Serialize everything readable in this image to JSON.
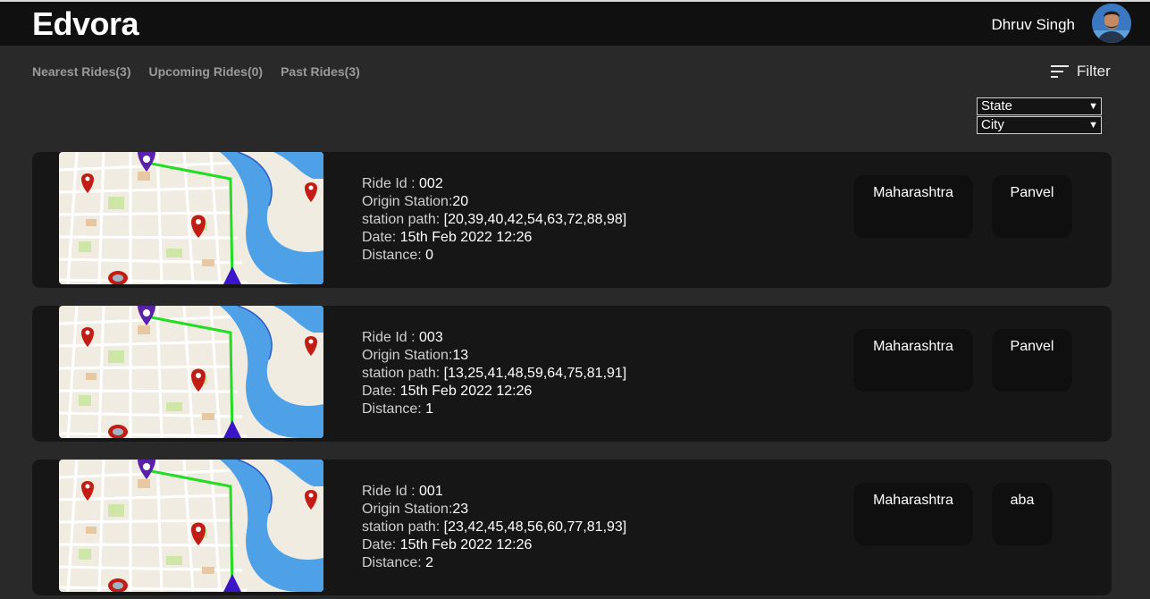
{
  "header": {
    "brand": "Edvora",
    "user_name": "Dhruv Singh"
  },
  "tabs": [
    {
      "label": "Nearest Rides(3)"
    },
    {
      "label": "Upcoming Rides(0)"
    },
    {
      "label": "Past Rides(3)"
    }
  ],
  "filter": {
    "label": "Filter",
    "state_select": "State",
    "city_select": "City"
  },
  "labels": {
    "ride_id": "Ride Id : ",
    "origin_station": "Origin Station:",
    "station_path": "station path: ",
    "date": "Date: ",
    "distance": "Distance: "
  },
  "rides": [
    {
      "ride_id": "002",
      "origin_station": "20",
      "station_path": "[20,39,40,42,54,63,72,88,98]",
      "date": "15th Feb 2022 12:26",
      "distance": "0",
      "state": "Maharashtra",
      "city": "Panvel"
    },
    {
      "ride_id": "003",
      "origin_station": "13",
      "station_path": "[13,25,41,48,59,64,75,81,91]",
      "date": "15th Feb 2022 12:26",
      "distance": "1",
      "state": "Maharashtra",
      "city": "Panvel"
    },
    {
      "ride_id": "001",
      "origin_station": "23",
      "station_path": "[23,42,45,48,56,60,77,81,93]",
      "date": "15th Feb 2022 12:26",
      "distance": "2",
      "state": "Maharashtra",
      "city": "aba"
    }
  ],
  "colors": {
    "background": "#292929",
    "topbar": "#101010",
    "card": "#161616",
    "chip": "#0f0f0f",
    "tab_text": "#9a9a9a",
    "route_line": "#22dd22",
    "map_water": "#4ea1e6"
  },
  "icons": {
    "filter": "filter-lines-icon",
    "map_start": "map-pin-purple-icon",
    "map_end": "navigation-arrow-icon",
    "map_poi": "map-pin-red-icon"
  }
}
